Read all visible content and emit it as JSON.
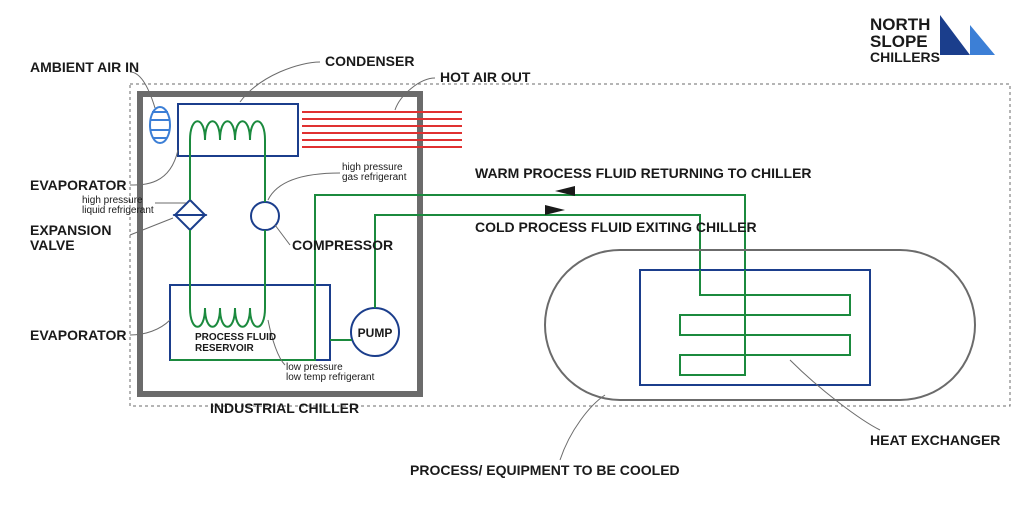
{
  "logo": {
    "line1": "NORTH",
    "line2": "SLOPE",
    "line3": "CHILLERS"
  },
  "labels": {
    "ambient": "AMBIENT AIR IN",
    "condenser": "CONDENSER",
    "hot": "HOT AIR OUT",
    "evap1": "EVAPORATOR",
    "hp_liquid1": "high pressure",
    "hp_liquid2": "liquid refrigerant",
    "expvalve1": "EXPANSION",
    "expvalve2": "VALVE",
    "compressor": "COMPRESSOR",
    "hp_gas1": "high pressure",
    "hp_gas2": "gas refrigerant",
    "pump": "PUMP",
    "evap2": "EVAPORATOR",
    "reservoir1": "PROCESS FLUID",
    "reservoir2": "RESERVOIR",
    "lp_ref1": "low pressure",
    "lp_ref2": "low temp refrigerant",
    "chiller": "INDUSTRIAL CHILLER",
    "warm": "WARM PROCESS FLUID RETURNING TO CHILLER",
    "cold": "COLD PROCESS FLUID EXITING CHILLER",
    "hex": "HEAT EXCHANGER",
    "process": "PROCESS/ EQUIPMENT TO BE COOLED"
  },
  "colors": {
    "blue": "#1b3e8c",
    "green": "#1b8a3e",
    "gray": "#6b6b6b",
    "red": "#e03131",
    "lightblue": "#3c7fd6"
  }
}
